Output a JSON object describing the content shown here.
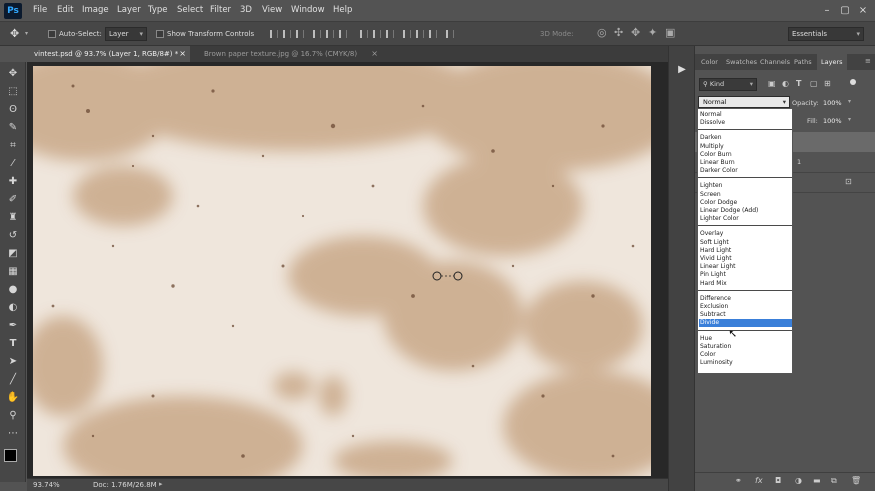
{
  "app": {
    "logo": "Ps"
  },
  "menubar": {
    "items": [
      "File",
      "Edit",
      "Image",
      "Layer",
      "Type",
      "Select",
      "Filter",
      "3D",
      "View",
      "Window",
      "Help"
    ]
  },
  "options": {
    "auto_select_label": "Auto-Select:",
    "auto_select_value": "Layer",
    "transform_label": "Show Transform Controls",
    "mode_3d": "3D Mode:",
    "workspace": "Essentials"
  },
  "tabs": [
    {
      "label": "vintest.psd @ 93.7% (Layer 1, RGB/8#) *",
      "close": "×"
    },
    {
      "label": "Brown paper texture.jpg @ 16.7% (CMYK/8)",
      "close": "×"
    }
  ],
  "status": {
    "zoom": "93.74%",
    "doc": "Doc: 1.76M/26.8M"
  },
  "panel": {
    "tabs": [
      "Color",
      "Swatches",
      "Channels",
      "Paths",
      "Layers"
    ],
    "kind_label": "Kind",
    "blend_mode": "Normal",
    "opacity_label": "Opacity:",
    "opacity_value": "100%",
    "fill_label": "Fill:",
    "fill_value": "100%",
    "layer_name": "1"
  },
  "blend_modes": {
    "groups": [
      [
        "Normal",
        "Dissolve"
      ],
      [
        "Darken",
        "Multiply",
        "Color Burn",
        "Linear Burn",
        "Darker Color"
      ],
      [
        "Lighten",
        "Screen",
        "Color Dodge",
        "Linear Dodge (Add)",
        "Lighter Color"
      ],
      [
        "Overlay",
        "Soft Light",
        "Hard Light",
        "Vivid Light",
        "Linear Light",
        "Pin Light",
        "Hard Mix"
      ],
      [
        "Difference",
        "Exclusion",
        "Subtract",
        "Divide"
      ],
      [
        "Hue",
        "Saturation",
        "Color",
        "Luminosity"
      ]
    ],
    "highlighted": "Divide"
  },
  "colors": {
    "accent": "#3a7fd9",
    "paper": "#efe6dc",
    "stain": "#c9a888",
    "ui_dark": "#535353"
  },
  "icons": {
    "move": "move-icon",
    "marquee": "marquee-icon",
    "lasso": "lasso-icon",
    "quick_select": "quick-select-icon",
    "crop": "crop-icon",
    "eyedropper": "eyedropper-icon",
    "healing": "healing-brush-icon",
    "brush": "brush-icon",
    "stamp": "clone-stamp-icon",
    "history": "history-brush-icon",
    "eraser": "eraser-icon",
    "gradient": "gradient-icon",
    "blur": "blur-icon",
    "dodge": "dodge-icon",
    "pen": "pen-icon",
    "type": "type-icon",
    "path_select": "path-select-icon",
    "line": "line-icon",
    "hand": "hand-icon",
    "zoom": "zoom-icon",
    "more": "more-icon"
  }
}
